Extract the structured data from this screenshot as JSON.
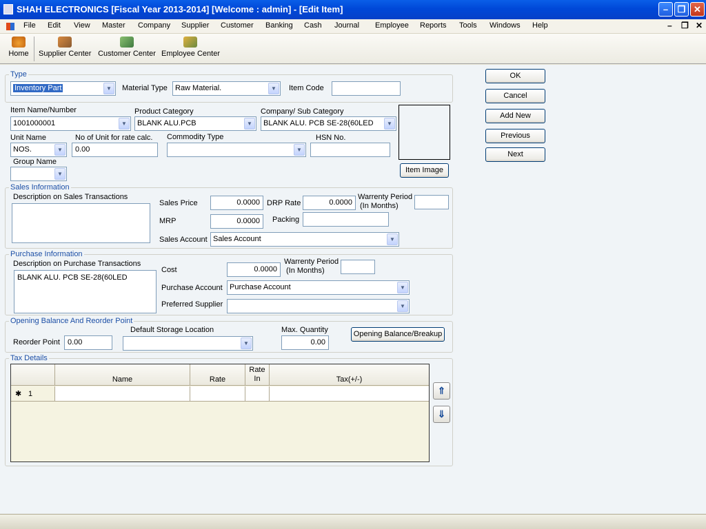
{
  "window": {
    "title": "SHAH ELECTRONICS  [Fiscal Year 2013-2014]  [Welcome : admin] - [Edit Item]"
  },
  "menu": [
    "File",
    "Edit",
    "View",
    "Master",
    "Company",
    "Supplier",
    "Customer",
    "Banking",
    "Cash",
    "Journal",
    "Employee",
    "Reports",
    "Tools",
    "Windows",
    "Help"
  ],
  "toolbar": {
    "items": [
      {
        "label": "Home",
        "icon": "home-icon"
      },
      {
        "label": "Supplier Center",
        "icon": "supplier-center-icon"
      },
      {
        "label": "Customer Center",
        "icon": "customer-center-icon"
      },
      {
        "label": "Employee Center",
        "icon": "employee-center-icon"
      }
    ]
  },
  "type_group": {
    "title": "Type",
    "type_value": "Inventory Part",
    "material_type_label": "Material Type",
    "material_type_value": "Raw Material.",
    "item_code_label": "Item Code",
    "item_code_value": ""
  },
  "item": {
    "name_label": "Item Name/Number",
    "name_value": "1001000001",
    "product_category_label": "Product Category",
    "product_category_value": "BLANK ALU.PCB",
    "sub_category_label": "Company/ Sub Category",
    "sub_category_value": "BLANK ALU. PCB SE-28(60LED",
    "unit_name_label": "Unit Name",
    "unit_name_value": "NOS.",
    "no_of_unit_label": "No of Unit for rate calc.",
    "no_of_unit_value": "0.00",
    "commodity_type_label": "Commodity Type",
    "commodity_type_value": "",
    "hsn_label": "HSN No.",
    "hsn_value": "",
    "group_name_label": "Group Name",
    "group_name_value": "",
    "item_image_button": "Item Image"
  },
  "sales": {
    "title": "Sales Information",
    "description_label": "Description on Sales Transactions",
    "description_value": "",
    "sales_price_label": "Sales Price",
    "sales_price_value": "0.0000",
    "drp_rate_label": "DRP Rate",
    "drp_rate_value": "0.0000",
    "warranty_label_1": "Warrenty Period",
    "warranty_label_2": "(In Months)",
    "warranty_value": "",
    "mrp_label": "MRP",
    "mrp_value": "0.0000",
    "packing_label": "Packing",
    "packing_value": "",
    "sales_account_label": "Sales Account",
    "sales_account_value": "Sales Account"
  },
  "purchase": {
    "title": "Purchase Information",
    "description_label": "Description on Purchase Transactions",
    "description_value": "BLANK ALU. PCB SE-28(60LED",
    "cost_label": "Cost",
    "cost_value": "0.0000",
    "warranty_label_1": "Warrenty Period",
    "warranty_label_2": "(In Months)",
    "warranty_value": "",
    "purchase_account_label": "Purchase Account",
    "purchase_account_value": "Purchase Account",
    "preferred_supplier_label": "Preferred Supplier",
    "preferred_supplier_value": ""
  },
  "opening": {
    "title": "Opening Balance And Reorder Point",
    "reorder_label": "Reorder Point",
    "reorder_value": "0.00",
    "storage_label": "Default Storage Location",
    "storage_value": "",
    "max_qty_label": "Max. Quantity",
    "max_qty_value": "0.00",
    "breakup_button": "Opening Balance/Breakup"
  },
  "tax": {
    "title": "Tax Details",
    "columns": {
      "name": "Name",
      "rate": "Rate",
      "rate_in_1": "Rate",
      "rate_in_2": "In",
      "tax": "Tax(+/-)"
    },
    "row_marker": "✱",
    "row_number": "1"
  },
  "actions": {
    "ok": "OK",
    "cancel": "Cancel",
    "add_new": "Add New",
    "previous": "Previous",
    "next": "Next"
  },
  "colors": {
    "title_bar": "#0a5fe8",
    "group_title": "#1c4fa6",
    "mdi_background": "#f0f4f7"
  }
}
